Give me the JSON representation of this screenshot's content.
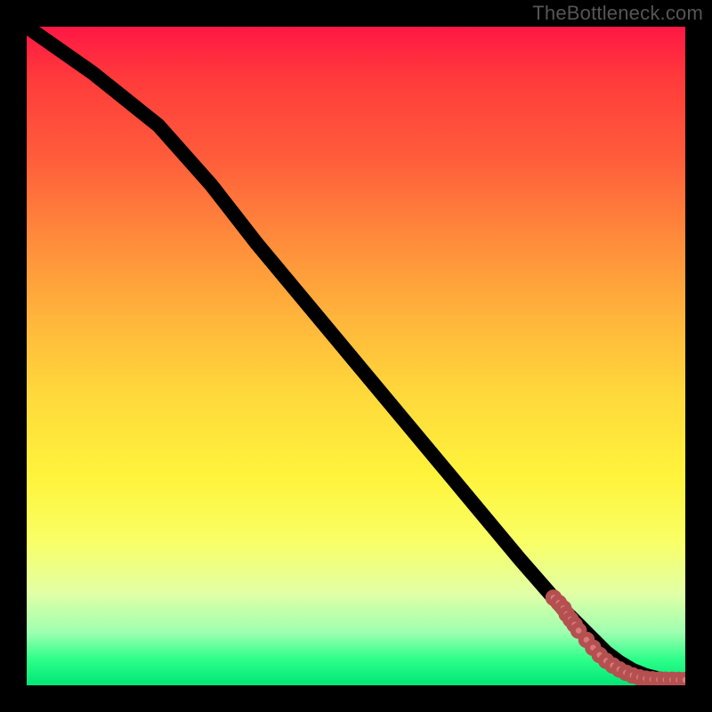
{
  "branding": {
    "watermark": "TheBottleneck.com"
  },
  "chart_data": {
    "type": "line",
    "title": "",
    "xlabel": "",
    "ylabel": "",
    "xlim": [
      0,
      100
    ],
    "ylim": [
      0,
      100
    ],
    "grid": false,
    "background": "vertical-gradient-red-to-green",
    "line": {
      "x": [
        0,
        10,
        20,
        28,
        35,
        45,
        55,
        65,
        75,
        82,
        86,
        88,
        90,
        92,
        94,
        96,
        98,
        100
      ],
      "y": [
        100,
        93,
        85,
        76,
        67,
        55,
        43,
        31,
        19,
        11,
        7,
        5,
        3.5,
        2.3,
        1.5,
        1,
        0.7,
        0.7
      ]
    },
    "scatter_overlay": {
      "x": [
        80,
        80.8,
        81.5,
        82,
        82.6,
        83.2,
        83.8,
        85,
        86,
        87,
        88,
        89,
        90,
        91,
        92,
        93,
        94,
        95,
        96,
        97,
        98,
        99,
        100
      ],
      "y": [
        13.3,
        12.5,
        11.7,
        10.8,
        10,
        9.2,
        8.3,
        6.9,
        5.7,
        4.6,
        3.7,
        3,
        2.4,
        1.9,
        1.5,
        1.2,
        1,
        0.9,
        0.85,
        0.83,
        0.82,
        0.81,
        0.8
      ]
    }
  }
}
